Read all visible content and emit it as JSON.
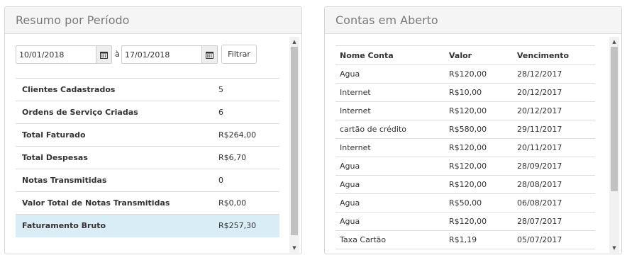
{
  "summary_panel": {
    "title": "Resumo por Período",
    "filter": {
      "start_date": "10/01/2018",
      "separator": "à",
      "end_date": "17/01/2018",
      "button_label": "Filtrar"
    },
    "rows": [
      {
        "label": "Clientes Cadastrados",
        "value": "5"
      },
      {
        "label": "Ordens de Serviço Criadas",
        "value": "6"
      },
      {
        "label": "Total Faturado",
        "value": "R$264,00"
      },
      {
        "label": "Total Despesas",
        "value": "R$6,70"
      },
      {
        "label": "Notas Transmitidas",
        "value": "0"
      },
      {
        "label": "Valor Total de Notas Transmitidas",
        "value": "R$0,00"
      },
      {
        "label": "Faturamento Bruto",
        "value": "R$257,30"
      }
    ]
  },
  "accounts_panel": {
    "title": "Contas em Aberto",
    "columns": [
      "Nome Conta",
      "Valor",
      "Vencimento"
    ],
    "rows": [
      [
        "Agua",
        "R$120,00",
        "28/12/2017"
      ],
      [
        "Internet",
        "R$10,00",
        "20/12/2017"
      ],
      [
        "Internet",
        "R$120,00",
        "20/12/2017"
      ],
      [
        "cartão de crédito",
        "R$580,00",
        "29/11/2017"
      ],
      [
        "Internet",
        "R$120,00",
        "20/11/2017"
      ],
      [
        "Agua",
        "R$120,00",
        "28/09/2017"
      ],
      [
        "Agua",
        "R$120,00",
        "28/08/2017"
      ],
      [
        "Agua",
        "R$50,00",
        "06/08/2017"
      ],
      [
        "Agua",
        "R$120,00",
        "28/07/2017"
      ],
      [
        "Taxa Cartão",
        "R$1,19",
        "05/07/2017"
      ]
    ]
  },
  "colors": {
    "highlight_row": "#d9edf7",
    "heading_bg": "#f5f5f5",
    "heading_text": "#7a7a7a"
  },
  "icons": {
    "calendar": "calendar-icon",
    "scroll_up": "arrow-up-icon",
    "scroll_down": "arrow-down-icon"
  }
}
